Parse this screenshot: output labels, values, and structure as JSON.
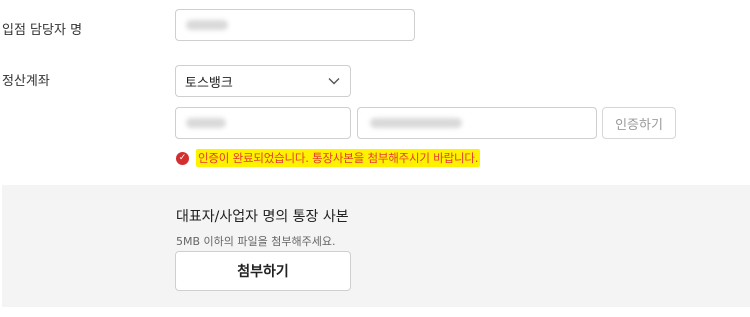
{
  "form": {
    "manager_name_label": "입점 담당자 명",
    "settlement_account_label": "정산계좌",
    "bank_select_value": "토스뱅크",
    "verify_button_label": "인증하기",
    "verification_message": "인증이 완료되었습니다. 통장사본을 첨부해주시기 바랍니다."
  },
  "attachment": {
    "title": "대표자/사업자 명의 통장 사본",
    "subtitle": "5MB 이하의 파일을 첨부해주세요.",
    "attach_button_label": "첨부하기"
  },
  "icons": {
    "select_chevron": "chevron-down-icon",
    "message_icon": "check-icon"
  },
  "colors": {
    "message_text": "#e53935",
    "highlight": "#fff200",
    "status_icon": "#d32f2f",
    "panel_background": "#f4f4f5"
  }
}
